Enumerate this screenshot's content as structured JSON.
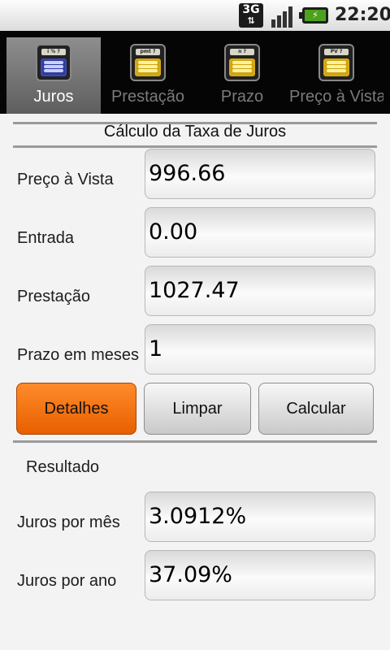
{
  "status_bar": {
    "network": "3G",
    "network_arrows": "⇅",
    "clock": "22:20",
    "battery_glyph": "⚡"
  },
  "tabs": [
    {
      "label": "Juros",
      "lcd": "i % ?",
      "active": true
    },
    {
      "label": "Prestação",
      "lcd": "pmt ?",
      "active": false
    },
    {
      "label": "Prazo",
      "lcd": "n ?",
      "active": false
    },
    {
      "label": "Preço à Vista",
      "lcd": "PV ?",
      "active": false
    }
  ],
  "form": {
    "title": "Cálculo da Taxa de Juros",
    "fields": [
      {
        "label": "Preço à Vista",
        "value": "996.66"
      },
      {
        "label": "Entrada",
        "value": "0.00"
      },
      {
        "label": "Prestação",
        "value": "1027.47"
      },
      {
        "label": "Prazo em meses",
        "value": "1"
      }
    ]
  },
  "buttons": {
    "details": "Detalhes",
    "clear": "Limpar",
    "calculate": "Calcular"
  },
  "result": {
    "title": "Resultado",
    "fields": [
      {
        "label": "Juros por mês",
        "value": "3.0912%"
      },
      {
        "label": "Juros por ano",
        "value": "37.09%"
      }
    ]
  }
}
